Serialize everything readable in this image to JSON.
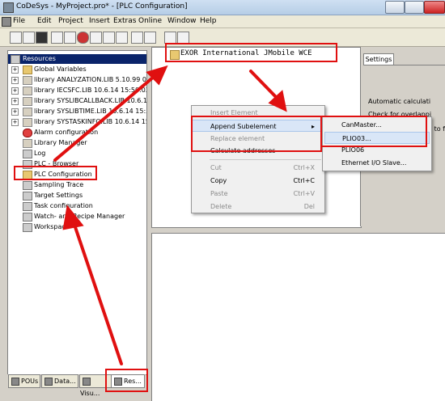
{
  "window": {
    "title": "CoDeSys - MyProject.pro* - [PLC Configuration]"
  },
  "menubar": [
    "File",
    "Edit",
    "Project",
    "Insert",
    "Extras",
    "Online",
    "Window",
    "Help"
  ],
  "tree": {
    "root": "Resources",
    "items": [
      {
        "label": "Global Variables",
        "icon": "folder-icon"
      },
      {
        "label": "library ANALYZATION.LIB 5.10.99 09:0",
        "icon": "library-icon"
      },
      {
        "label": "library IECSFC.LIB 10.6.14 15:50:02:",
        "icon": "library-icon"
      },
      {
        "label": "library SYSLIBCALLBACK.LIB 10.6.14 1",
        "icon": "library-icon"
      },
      {
        "label": "library SYSLIBTIME.LIB 10.6.14 15:50:",
        "icon": "library-icon"
      },
      {
        "label": "library SYSTASKINFO.LIB 10.6.14 15:5",
        "icon": "library-icon"
      },
      {
        "label": "Alarm configuration",
        "icon": "alarm-icon"
      },
      {
        "label": "Library Manager",
        "icon": "library-manager-icon"
      },
      {
        "label": "Log",
        "icon": "log-icon"
      },
      {
        "label": "PLC - Browser",
        "icon": "browser-icon"
      },
      {
        "label": "PLC Configuration",
        "icon": "plc-config-icon"
      },
      {
        "label": "Sampling Trace",
        "icon": "trace-icon"
      },
      {
        "label": "Target Settings",
        "icon": "target-icon"
      },
      {
        "label": "Task configuration",
        "icon": "task-icon"
      },
      {
        "label": "Watch- and Recipe Manager",
        "icon": "watch-icon"
      },
      {
        "label": "Workspace",
        "icon": "workspace-icon"
      }
    ]
  },
  "bottom_tabs": [
    "POUs",
    "Data...",
    "Visu...",
    "Res..."
  ],
  "config_root": "EXOR International JMobile WCE",
  "settings": {
    "tab": "Settings",
    "lines": [
      "Automatic calculati",
      "Check for overlappi",
      "n to f"
    ]
  },
  "context_menu": {
    "items": [
      {
        "label": "Insert Element",
        "shortcut": "",
        "disabled": true
      },
      {
        "label": "Append Subelement",
        "shortcut": "▸",
        "disabled": false
      },
      {
        "label": "Replace element",
        "shortcut": "",
        "disabled": true
      },
      {
        "label": "Calculate addresses",
        "shortcut": "",
        "disabled": false
      },
      {
        "label": "Cut",
        "shortcut": "Ctrl+X",
        "disabled": true
      },
      {
        "label": "Copy",
        "shortcut": "Ctrl+C",
        "disabled": false
      },
      {
        "label": "Paste",
        "shortcut": "Ctrl+V",
        "disabled": true
      },
      {
        "label": "Delete",
        "shortcut": "Del",
        "disabled": true
      }
    ]
  },
  "submenu": {
    "items": [
      "CanMaster...",
      "PLIO03...",
      "PLIO06",
      "Ethernet I/O Slave..."
    ]
  },
  "annotation_color": "#e01010",
  "selection_color": "#0a246a"
}
